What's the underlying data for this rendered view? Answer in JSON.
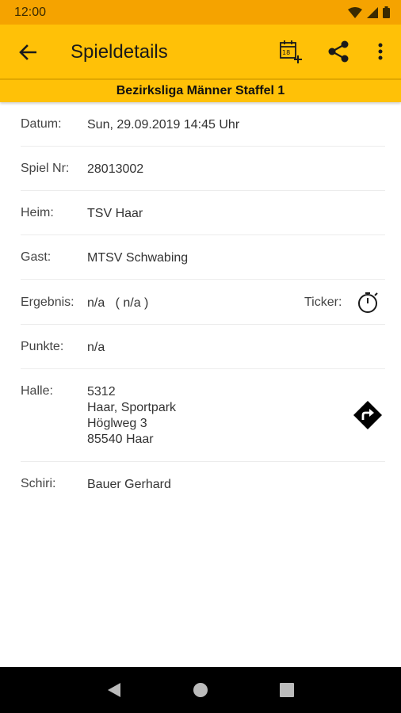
{
  "status": {
    "time": "12:00"
  },
  "appbar": {
    "title": "Spieldetails",
    "icons": {
      "back": "arrow-back-icon",
      "calendar": "calendar-add-icon",
      "share": "share-icon",
      "more": "more-vert-icon"
    }
  },
  "league": "Bezirksliga Männer Staffel 1",
  "details": {
    "datum": {
      "label": "Datum:",
      "value": "Sun, 29.09.2019   14:45 Uhr"
    },
    "spielnr": {
      "label": "Spiel Nr:",
      "value": "28013002"
    },
    "heim": {
      "label": "Heim:",
      "value": "TSV Haar"
    },
    "gast": {
      "label": "Gast:",
      "value": "MTSV Schwabing"
    },
    "ergebnis": {
      "label": "Ergebnis:",
      "value": "n/a   ( n/a )",
      "ticker_label": "Ticker:"
    },
    "punkte": {
      "label": "Punkte:",
      "value": "n/a"
    },
    "halle": {
      "label": "Halle:",
      "line1": "5312",
      "line2": "Haar, Sportpark",
      "line3": "Höglweg 3",
      "line4": "85540 Haar"
    },
    "schiri": {
      "label": "Schiri:",
      "value": "Bauer Gerhard"
    }
  },
  "colors": {
    "status_bar": "#F5A300",
    "app_bar": "#FFC107",
    "nav_bar": "#000000"
  }
}
